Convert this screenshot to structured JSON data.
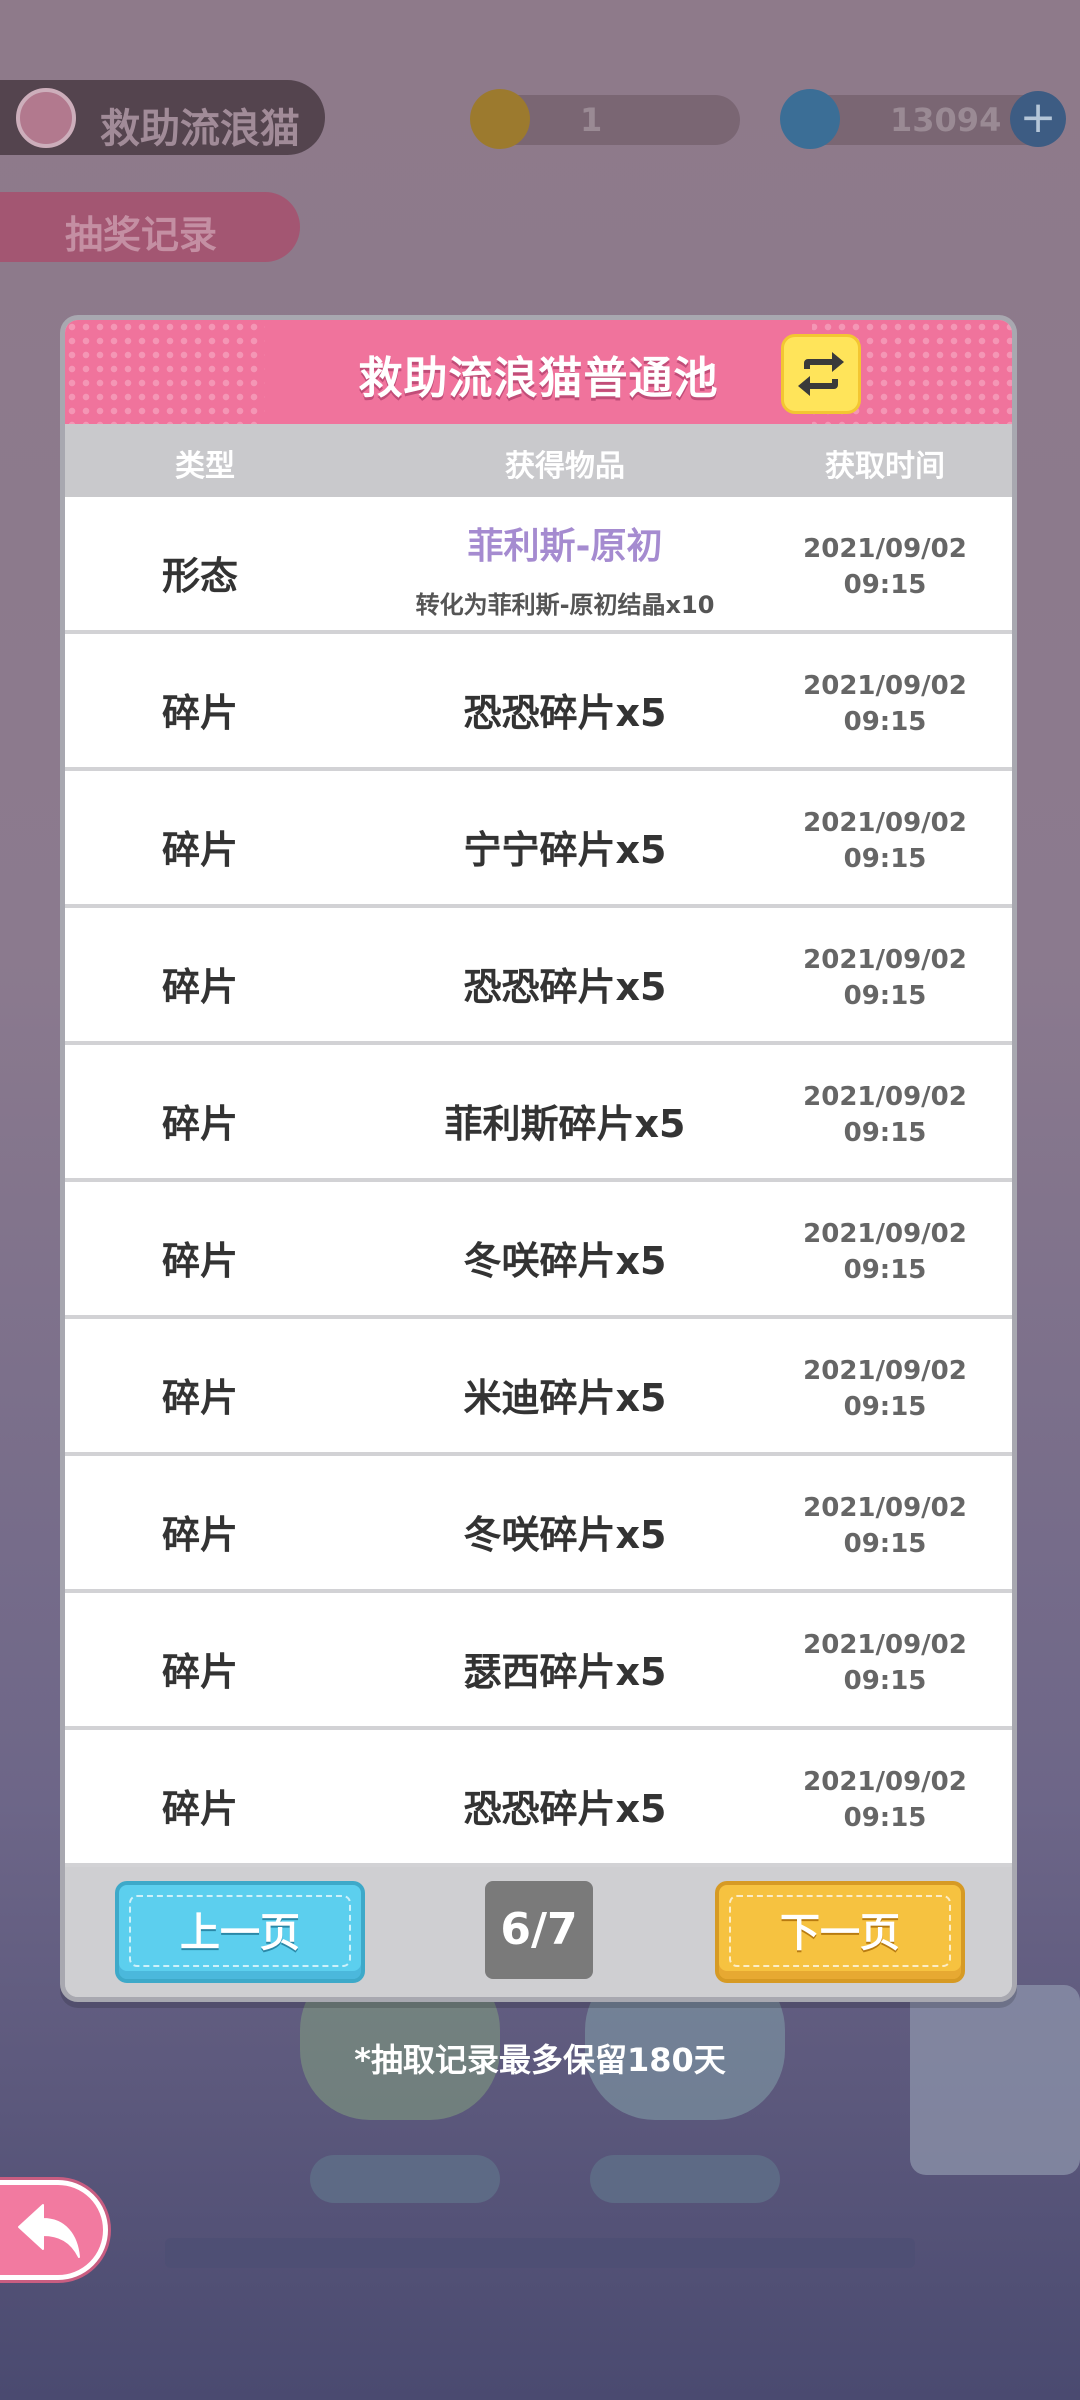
{
  "hud": {
    "profile_name": "救助流浪猫",
    "coin_value": "1",
    "gem_value": "13094",
    "plus_glyph": "+",
    "record_tab": "抽奖记录"
  },
  "modal": {
    "title": "救助流浪猫普通池",
    "switch_icon": "swap-arrows-icon",
    "columns": {
      "type": "类型",
      "item": "获得物品",
      "time": "获取时间"
    },
    "rows": [
      {
        "type": "形态",
        "item": "菲利斯-原初",
        "sub": "转化为菲利斯-原初结晶x10",
        "date": "2021/09/02",
        "clock": "09:15"
      },
      {
        "type": "碎片",
        "item": "恐恐碎片x5",
        "date": "2021/09/02",
        "clock": "09:15"
      },
      {
        "type": "碎片",
        "item": "宁宁碎片x5",
        "date": "2021/09/02",
        "clock": "09:15"
      },
      {
        "type": "碎片",
        "item": "恐恐碎片x5",
        "date": "2021/09/02",
        "clock": "09:15"
      },
      {
        "type": "碎片",
        "item": "菲利斯碎片x5",
        "date": "2021/09/02",
        "clock": "09:15"
      },
      {
        "type": "碎片",
        "item": "冬咲碎片x5",
        "date": "2021/09/02",
        "clock": "09:15"
      },
      {
        "type": "碎片",
        "item": "米迪碎片x5",
        "date": "2021/09/02",
        "clock": "09:15"
      },
      {
        "type": "碎片",
        "item": "冬咲碎片x5",
        "date": "2021/09/02",
        "clock": "09:15"
      },
      {
        "type": "碎片",
        "item": "瑟西碎片x5",
        "date": "2021/09/02",
        "clock": "09:15"
      },
      {
        "type": "碎片",
        "item": "恐恐碎片x5",
        "date": "2021/09/02",
        "clock": "09:15"
      }
    ],
    "prev_label": "上一页",
    "next_label": "下一页",
    "page_indicator": "6/7"
  },
  "note": "*抽取记录最多保留180天",
  "colors": {
    "header_pink": "#f0739c",
    "special_item_purple": "#a58bd0",
    "prev_blue": "#5ccfee",
    "next_yellow": "#f6c240"
  }
}
